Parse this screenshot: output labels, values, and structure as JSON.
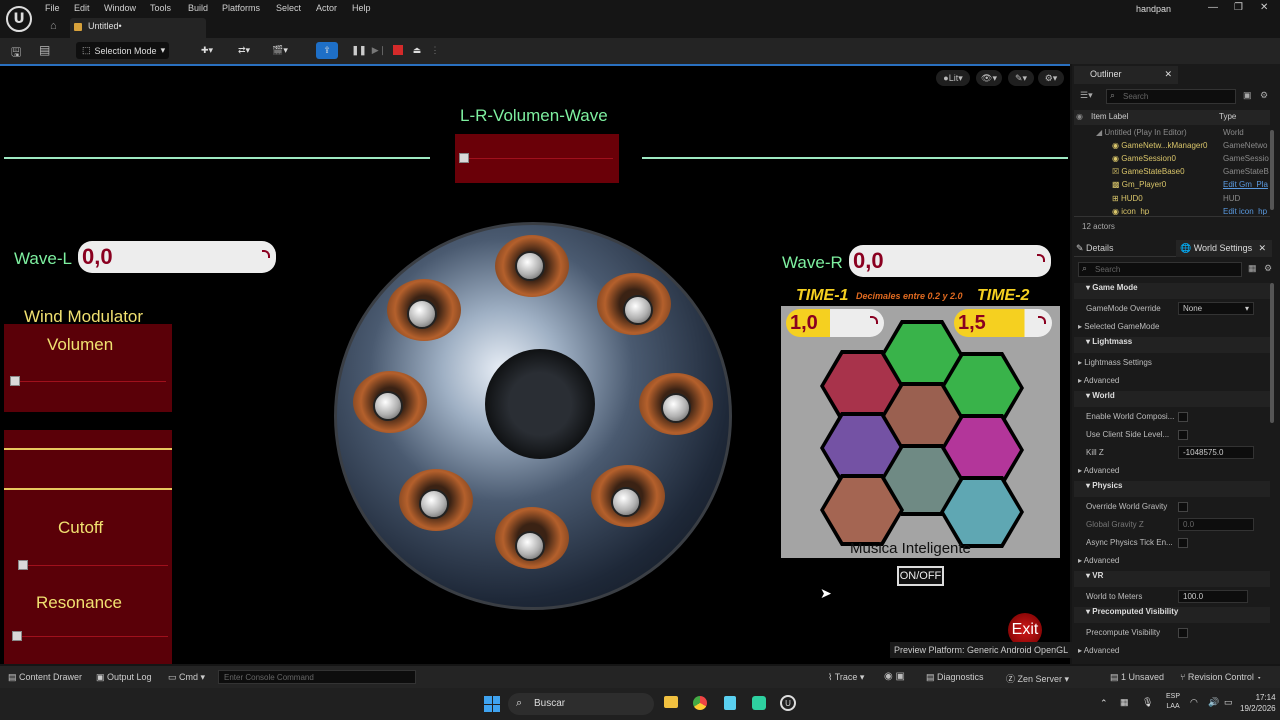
{
  "menu": [
    "File",
    "Edit",
    "Window",
    "Tools",
    "Build",
    "Platforms",
    "Select",
    "Actor",
    "Help"
  ],
  "project": "handpan",
  "tab_title": "Untitled•",
  "selection_mode": "Selection Mode",
  "viewport": {
    "lit": "Lit",
    "preview": "Preview Platform:  Generic Android OpenGL"
  },
  "game": {
    "lr_title": "L-R-Volumen-Wave",
    "wave_l_label": "Wave-L",
    "wave_l_value": "0,0",
    "wave_r_label": "Wave-R",
    "wave_r_value": "0,0",
    "wind_title": "Wind Modulator",
    "volumen": "Volumen",
    "cutoff": "Cutoff",
    "resonance": "Resonance",
    "time1": "TIME-1",
    "time2": "TIME-2",
    "time_hint": "Decimales entre 0.2 y 2.0",
    "time1_value": "1,0",
    "time2_value": "1,5",
    "musica": "Musica Inteligente",
    "onoff": "ON/OFF",
    "exit": "Exit",
    "hex_colors": [
      "#39b34a",
      "#a8334b",
      "#39b34a",
      "#9a6050",
      "#7452a4",
      "#b3369a",
      "#6f8a84",
      "#a46552",
      "#5fa7b3"
    ]
  },
  "outliner": {
    "title": "Outliner",
    "search": "Search",
    "col_label": "Item Label",
    "col_type": "Type",
    "rows": [
      {
        "label": "Untitled (Play In Editor)",
        "type": "World"
      },
      {
        "label": "GameNetw...kManager0",
        "type": "GameNetwo"
      },
      {
        "label": "GameSession0",
        "type": "GameSessio"
      },
      {
        "label": "GameStateBase0",
        "type": "GameStateB"
      },
      {
        "label": "Gm_Player0",
        "type": "Edit Gm_Pla"
      },
      {
        "label": "HUD0",
        "type": "HUD"
      },
      {
        "label": "icon_hp",
        "type": "Edit icon_hp"
      }
    ],
    "count": "12 actors"
  },
  "details": {
    "tab1": "Details",
    "tab2": "World Settings",
    "search": "Search",
    "game_mode": "Game Mode",
    "gamemode_override": "GameMode Override",
    "gm_value": "None",
    "selected_gm": "Selected GameMode",
    "lightmass": "Lightmass",
    "lightmass_settings": "Lightmass Settings",
    "advanced": "Advanced",
    "world": "World",
    "enable_world": "Enable World Composi...",
    "client_side": "Use Client Side Level...",
    "kill_z": "Kill Z",
    "kill_z_value": "-1048575.0",
    "physics": "Physics",
    "override_gravity": "Override World Gravity",
    "global_gravity": "Global Gravity Z",
    "gravity_value": "0.0",
    "async": "Async Physics Tick En...",
    "vr": "VR",
    "world_meters": "World to Meters",
    "meters_value": "100.0",
    "precomputed": "Precomputed Visibility",
    "precompute": "Precompute Visibility"
  },
  "status": {
    "content_drawer": "Content Drawer",
    "output_log": "Output Log",
    "cmd": "Cmd",
    "console_placeholder": "Enter Console Command",
    "trace": "Trace",
    "diagnostics": "Diagnostics",
    "zen": "Zen Server",
    "unsaved": "1 Unsaved",
    "revision": "Revision Control"
  },
  "taskbar": {
    "search": "Buscar",
    "lang1": "ESP",
    "lang2": "LAA",
    "time": "17:14",
    "date": "19/2/2026"
  }
}
